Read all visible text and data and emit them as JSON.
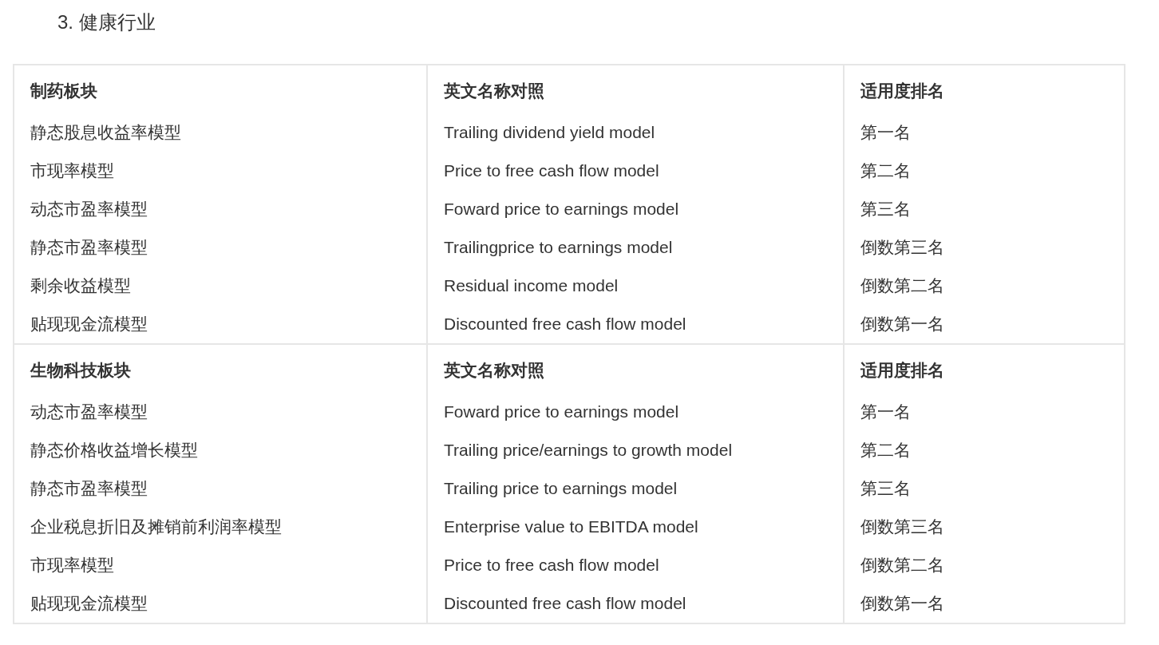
{
  "heading": "3. 健康行业",
  "table": {
    "sections": [
      {
        "header": [
          "制药板块",
          "英文名称对照",
          "适用度排名"
        ],
        "rows": [
          [
            "静态股息收益率模型",
            "Trailing dividend yield model",
            "第一名"
          ],
          [
            "市现率模型",
            "Price to free cash flow model",
            "第二名"
          ],
          [
            "动态市盈率模型",
            "Foward price to earnings model",
            "第三名"
          ],
          [
            "静态市盈率模型",
            "Trailingprice to earnings model",
            "倒数第三名"
          ],
          [
            "剩余收益模型",
            "Residual income model",
            "倒数第二名"
          ],
          [
            "贴现现金流模型",
            "Discounted free cash flow model",
            "倒数第一名"
          ]
        ]
      },
      {
        "header": [
          "生物科技板块",
          "英文名称对照",
          "适用度排名"
        ],
        "rows": [
          [
            "动态市盈率模型",
            "Foward price to earnings model",
            "第一名"
          ],
          [
            "静态价格收益增长模型",
            "Trailing price/earnings to growth model",
            "第二名"
          ],
          [
            "静态市盈率模型",
            "Trailing price to earnings model",
            "第三名"
          ],
          [
            "企业税息折旧及摊销前利润率模型",
            "Enterprise value to EBITDA model",
            "倒数第三名"
          ],
          [
            "市现率模型",
            "Price to free cash flow model",
            "倒数第二名"
          ],
          [
            "贴现现金流模型",
            "Discounted free cash flow model",
            "倒数第一名"
          ]
        ]
      }
    ]
  }
}
